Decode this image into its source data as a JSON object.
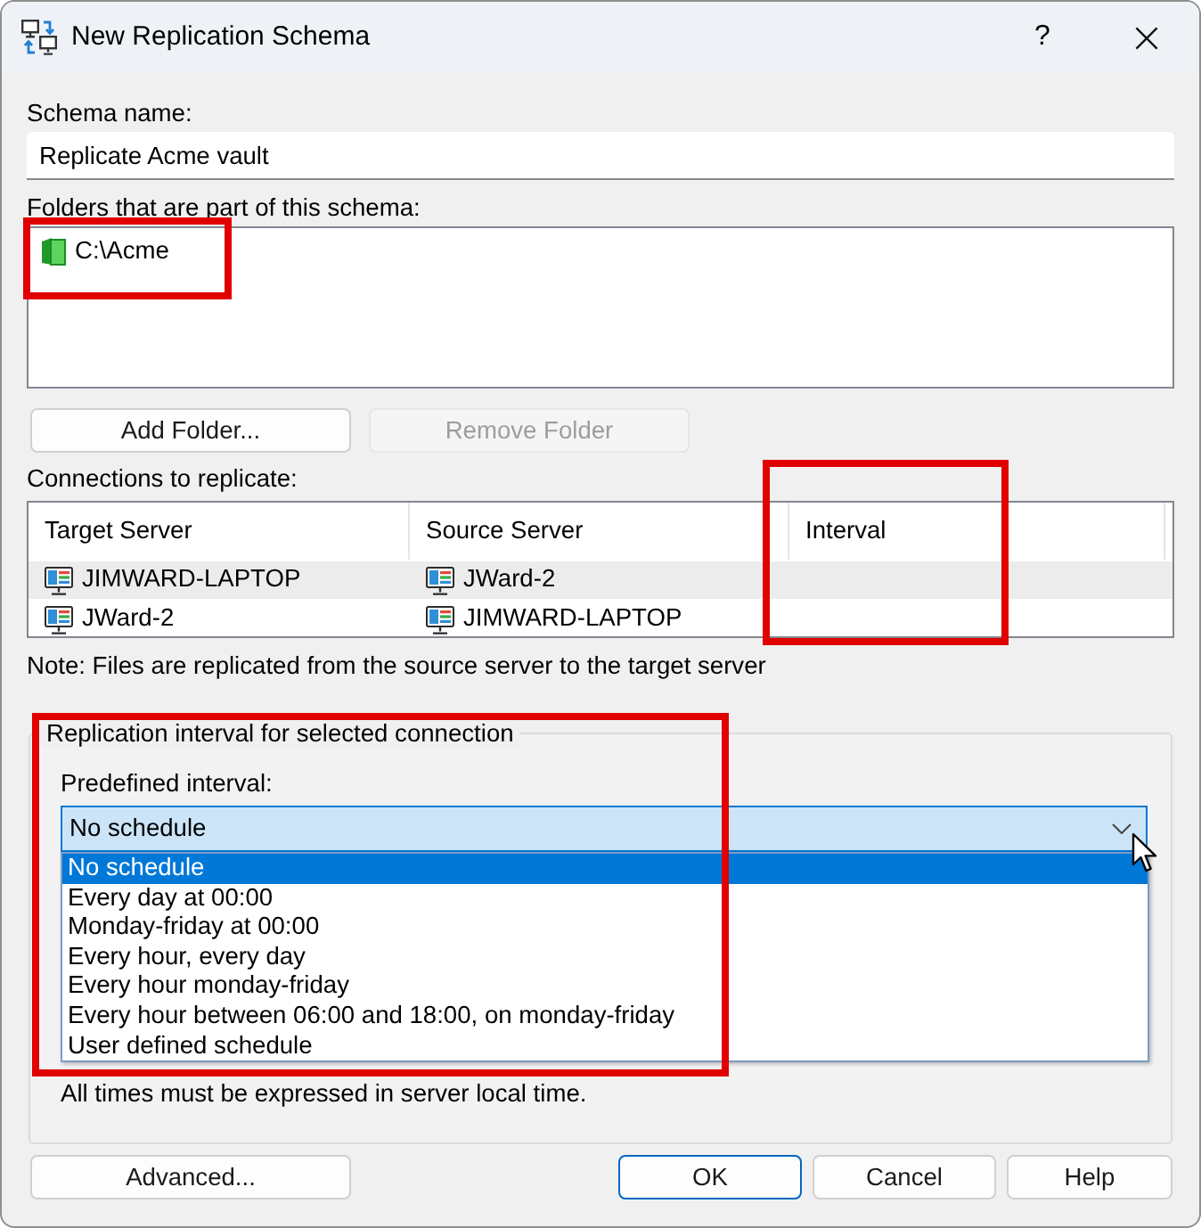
{
  "window": {
    "title": "New Replication Schema",
    "help_button": "?"
  },
  "schema_name": {
    "label": "Schema name:",
    "value": "Replicate Acme vault"
  },
  "folders": {
    "label": "Folders that are part of this schema:",
    "items": [
      {
        "path": "C:\\Acme"
      }
    ]
  },
  "folder_buttons": [
    {
      "label": "Add Folder...",
      "disabled": false
    },
    {
      "label": "Remove Folder",
      "disabled": true
    }
  ],
  "connections": {
    "label": "Connections to replicate:",
    "columns": [
      "Target Server",
      "Source Server",
      "Interval"
    ],
    "rows": [
      {
        "target_server": "JIMWARD-LAPTOP",
        "source_server": "JWard-2",
        "selected": true
      },
      {
        "target_server": "JWard-2",
        "source_server": "JIMWARD-LAPTOP",
        "selected": false
      }
    ]
  },
  "note": "Note: Files are replicated from the source server to the target server",
  "interval_group": {
    "title": "Replication interval for selected connection",
    "predefined_label": "Predefined interval:",
    "dropdown": {
      "value": "No schedule",
      "expanded": true,
      "options": [
        {
          "label": "No schedule",
          "selected": true
        },
        {
          "label": "Every day at 00:00",
          "selected": false
        },
        {
          "label": "Monday-friday at 00:00",
          "selected": false
        },
        {
          "label": "Every hour, every day",
          "selected": false
        },
        {
          "label": "Every hour monday-friday",
          "selected": false
        },
        {
          "label": "Every hour between 06:00 and 18:00, on monday-friday",
          "selected": false
        },
        {
          "label": "User defined schedule",
          "selected": false
        }
      ]
    },
    "footnote": "All times must be expressed in server local time."
  },
  "footer": {
    "left_buttons": [
      {
        "label": "Advanced...",
        "default": false
      }
    ],
    "right_buttons": [
      {
        "label": "OK",
        "default": true
      },
      {
        "label": "Cancel",
        "default": false
      },
      {
        "label": "Help",
        "default": false
      }
    ]
  }
}
